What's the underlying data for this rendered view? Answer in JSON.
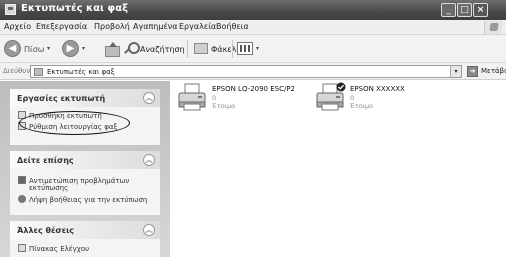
{
  "window": {
    "title": "Εκτυπωτές και φαξ"
  },
  "menu": {
    "items": [
      "Αρχείο",
      "Επεξεργασία",
      "Προβολή",
      "Αγαπημένα",
      "Εργαλεία",
      "Βοήθεια"
    ]
  },
  "toolbar": {
    "back_label": "Πίσω",
    "search_label": "Αναζήτηση",
    "folders_label": "Φάκελοι"
  },
  "address": {
    "label": "Διεύθυνση",
    "value": "Εκτυπωτές και φαξ",
    "go_label": "Μετάβαση"
  },
  "sidebar": {
    "printer_tasks": {
      "title": "Εργασίες εκτυπωτή",
      "items": [
        "Προσθήκη εκτυπωτή",
        "Ρύθμιση λειτουργίας φαξ"
      ]
    },
    "see_also": {
      "title": "Δείτε επίσης",
      "items": [
        "Αντιμετώπιση προβλημάτων",
        "εκτύπωσης",
        "Λήψη βοήθειας για την εκτύπωση"
      ]
    },
    "other_places": {
      "title": "Άλλες θέσεις",
      "items": [
        "Πίνακας Ελέγχου"
      ]
    }
  },
  "printers": [
    {
      "name": "EPSON LQ-2090 ESC/P2",
      "count": "0",
      "status": "Έτοιμο",
      "is_default": false
    },
    {
      "name": "EPSON XXXXXX",
      "count": "0",
      "status": "Έτοιμο",
      "is_default": true
    }
  ]
}
